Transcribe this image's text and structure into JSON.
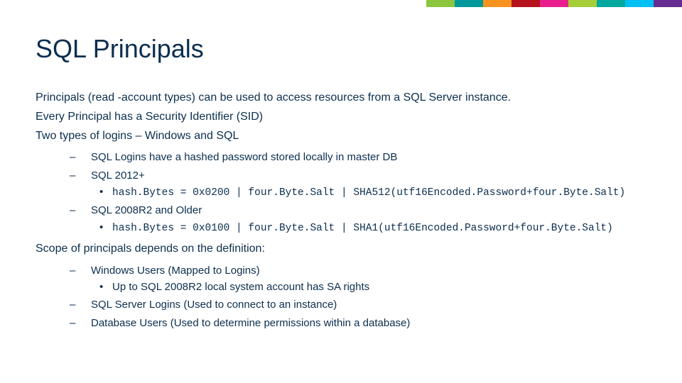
{
  "brand_colors": [
    "#8cc63f",
    "#009999",
    "#f7931e",
    "#b5121b",
    "#e91e8c",
    "#a6ce39",
    "#00a79d",
    "#00bff3",
    "#662d91"
  ],
  "title": "SQL Principals",
  "intro": {
    "l1": "Principals (read -account types) can be used to access resources from a SQL Server instance.",
    "l2": "Every Principal has a Security Identifier (SID)",
    "l3": "Two types of logins – Windows and SQL"
  },
  "logins": {
    "i1": "SQL Logins have a hashed password stored locally in master DB",
    "i2": "SQL 2012+",
    "i2_code": "hash.Bytes = 0x0200 | four.Byte.Salt | SHA512(utf16Encoded.Password+four.Byte.Salt)",
    "i3": "SQL 2008R2 and Older",
    "i3_code": "hash.Bytes = 0x0100 | four.Byte.Salt | SHA1(utf16Encoded.Password+four.Byte.Salt)"
  },
  "scope_heading": "Scope of principals depends on the definition:",
  "scope": {
    "s1": "Windows Users (Mapped to Logins)",
    "s1_sub": "Up to SQL 2008R2 local system account has SA rights",
    "s2": "SQL Server Logins (Used to connect to an instance)",
    "s3": "Database Users (Used to determine permissions within a database)"
  }
}
